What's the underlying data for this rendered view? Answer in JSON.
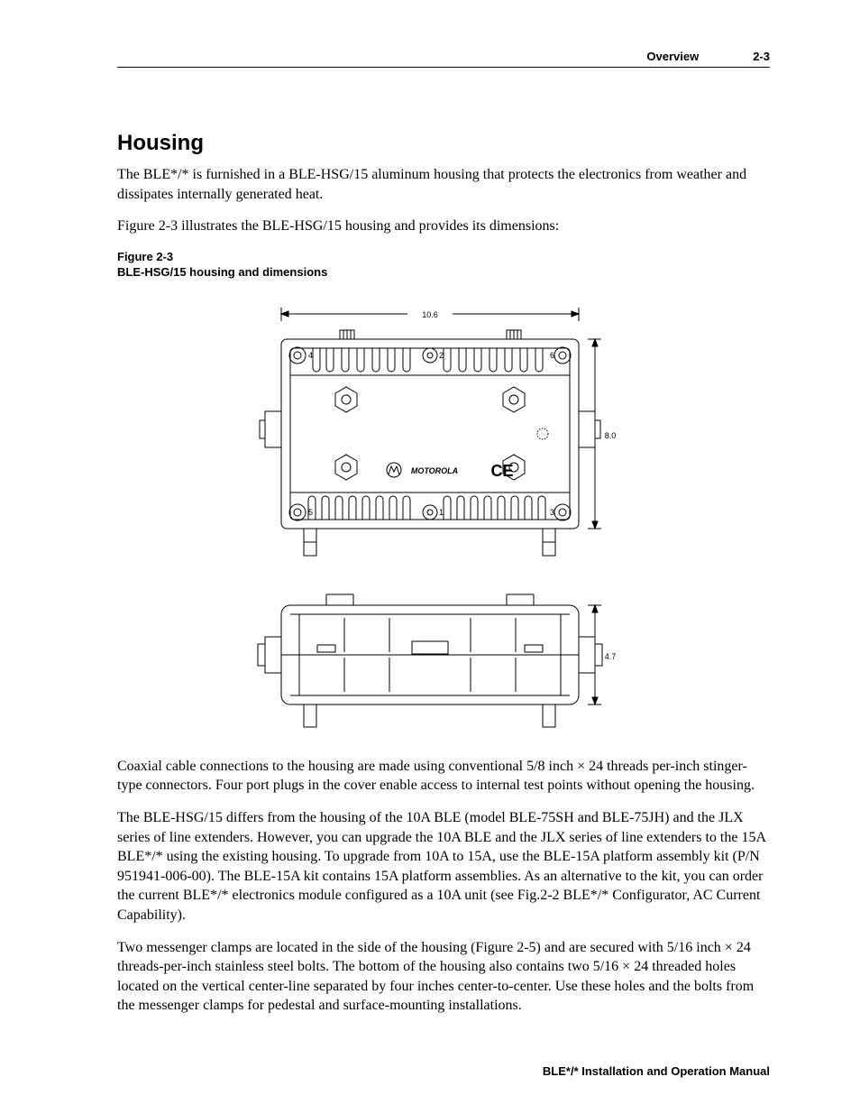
{
  "header": {
    "section": "Overview",
    "page": "2-3"
  },
  "section_title": "Housing",
  "paragraphs": {
    "p1": "The BLE*/* is furnished in a BLE-HSG/15 aluminum housing that protects the electronics from weather and dissipates internally generated heat.",
    "p2": "Figure 2-3 illustrates the BLE-HSG/15 housing and provides its dimensions:",
    "p3": "Coaxial cable connections to the housing are made using conventional 5/8 inch × 24 threads per-inch stinger-type connectors. Four port plugs in the cover enable access to internal test points without opening the housing.",
    "p4": "The BLE-HSG/15 differs from the housing of the 10A BLE (model BLE-75SH and BLE-75JH) and the JLX series of line extenders. However, you can upgrade the 10A BLE and the JLX series of line extenders to the 15A BLE*/* using the existing housing. To upgrade from 10A to 15A, use the BLE-15A platform assembly kit (P/N 951941-006-00). The BLE-15A kit contains 15A platform assemblies. As an alternative to the kit, you can order the current BLE*/* electronics module configured as a 10A unit (see Fig.2-2 BLE*/* Configurator, AC Current Capability).",
    "p5": "Two messenger clamps are located in the side of the housing (Figure 2-5) and are secured with 5/16 inch × 24 threads-per-inch stainless steel bolts. The bottom of the housing also contains two 5/16 × 24 threaded holes located on the vertical center-line separated by four inches center-to-center. Use these holes and the bolts from the messenger clamps for pedestal and surface-mounting installations."
  },
  "figure": {
    "label_line1": "Figure 2-3",
    "label_line2": "BLE-HSG/15 housing and dimensions",
    "dimensions": {
      "width": "10.6",
      "height": "8.0",
      "depth": "4.7"
    },
    "brand": "MOTOROLA",
    "ce_mark": "CE",
    "corner_labels": {
      "tl": "4",
      "tm": "2",
      "tr": "6",
      "bl": "5",
      "bm": "1",
      "br": "3"
    }
  },
  "footer": {
    "manual_title": "BLE*/* Installation and Operation Manual"
  }
}
